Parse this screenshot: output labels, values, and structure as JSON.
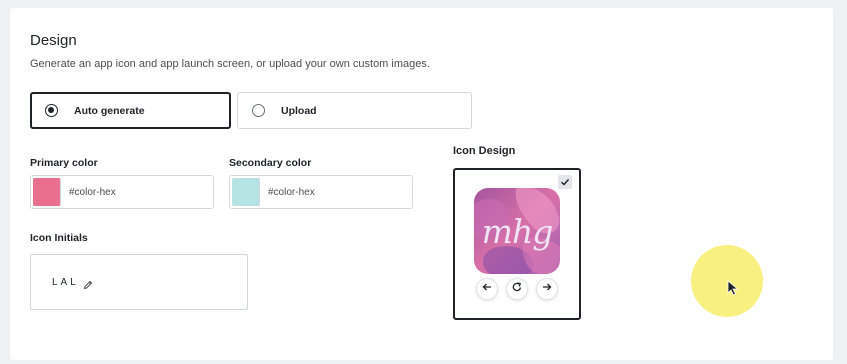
{
  "design": {
    "title": "Design",
    "description": "Generate an app icon and app launch screen, or upload your own custom images."
  },
  "mode_options": [
    {
      "label": "Auto generate",
      "selected": true
    },
    {
      "label": "Upload",
      "selected": false
    }
  ],
  "primary_color": {
    "label": "Primary color",
    "value": "#color-hex",
    "swatch": "#e8708e"
  },
  "secondary_color": {
    "label": "Secondary color",
    "value": "#color-hex",
    "swatch": "#b5e3e4"
  },
  "icon_initials": {
    "label": "Icon Initials",
    "value": "LAL",
    "edit_icon": "pencil-icon"
  },
  "icon_design": {
    "title": "Icon Design",
    "preview_text": "mhg",
    "selected": true,
    "controls": [
      "arrow-left-icon",
      "refresh-icon",
      "arrow-right-icon"
    ]
  }
}
